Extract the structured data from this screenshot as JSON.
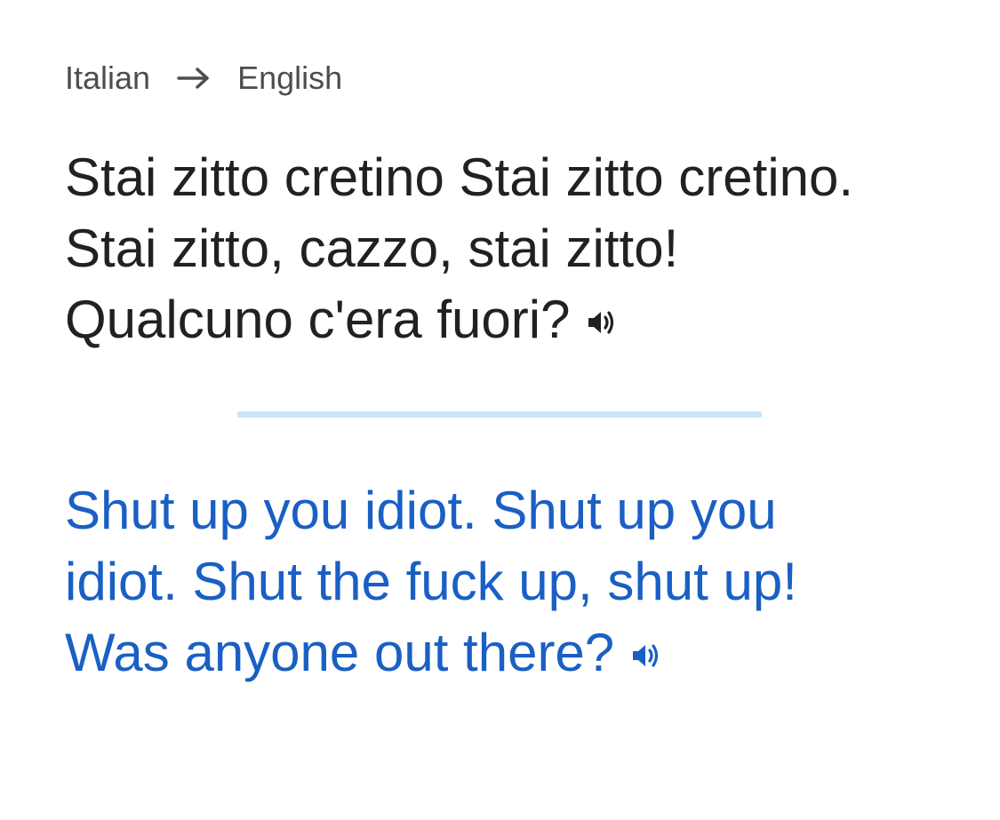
{
  "languages": {
    "source": "Italian",
    "target": "English",
    "arrow_icon": "arrow-right-icon"
  },
  "source": {
    "lines": [
      "Stai zitto cretino Stai zitto cretino.",
      "Stai zitto, cazzo, stai zitto!",
      "Qualcuno c'era fuori?"
    ],
    "speaker_icon": "speaker-icon"
  },
  "translation": {
    "lines": [
      "Shut up you idiot. Shut up you",
      "idiot. Shut the fuck up, shut up!",
      "Was anyone out there?"
    ],
    "speaker_icon": "speaker-icon"
  },
  "colors": {
    "source_text": "#202124",
    "translation_text": "#1a5fc4",
    "divider": "#c9e6f8",
    "label_text": "#4d4d4d"
  }
}
